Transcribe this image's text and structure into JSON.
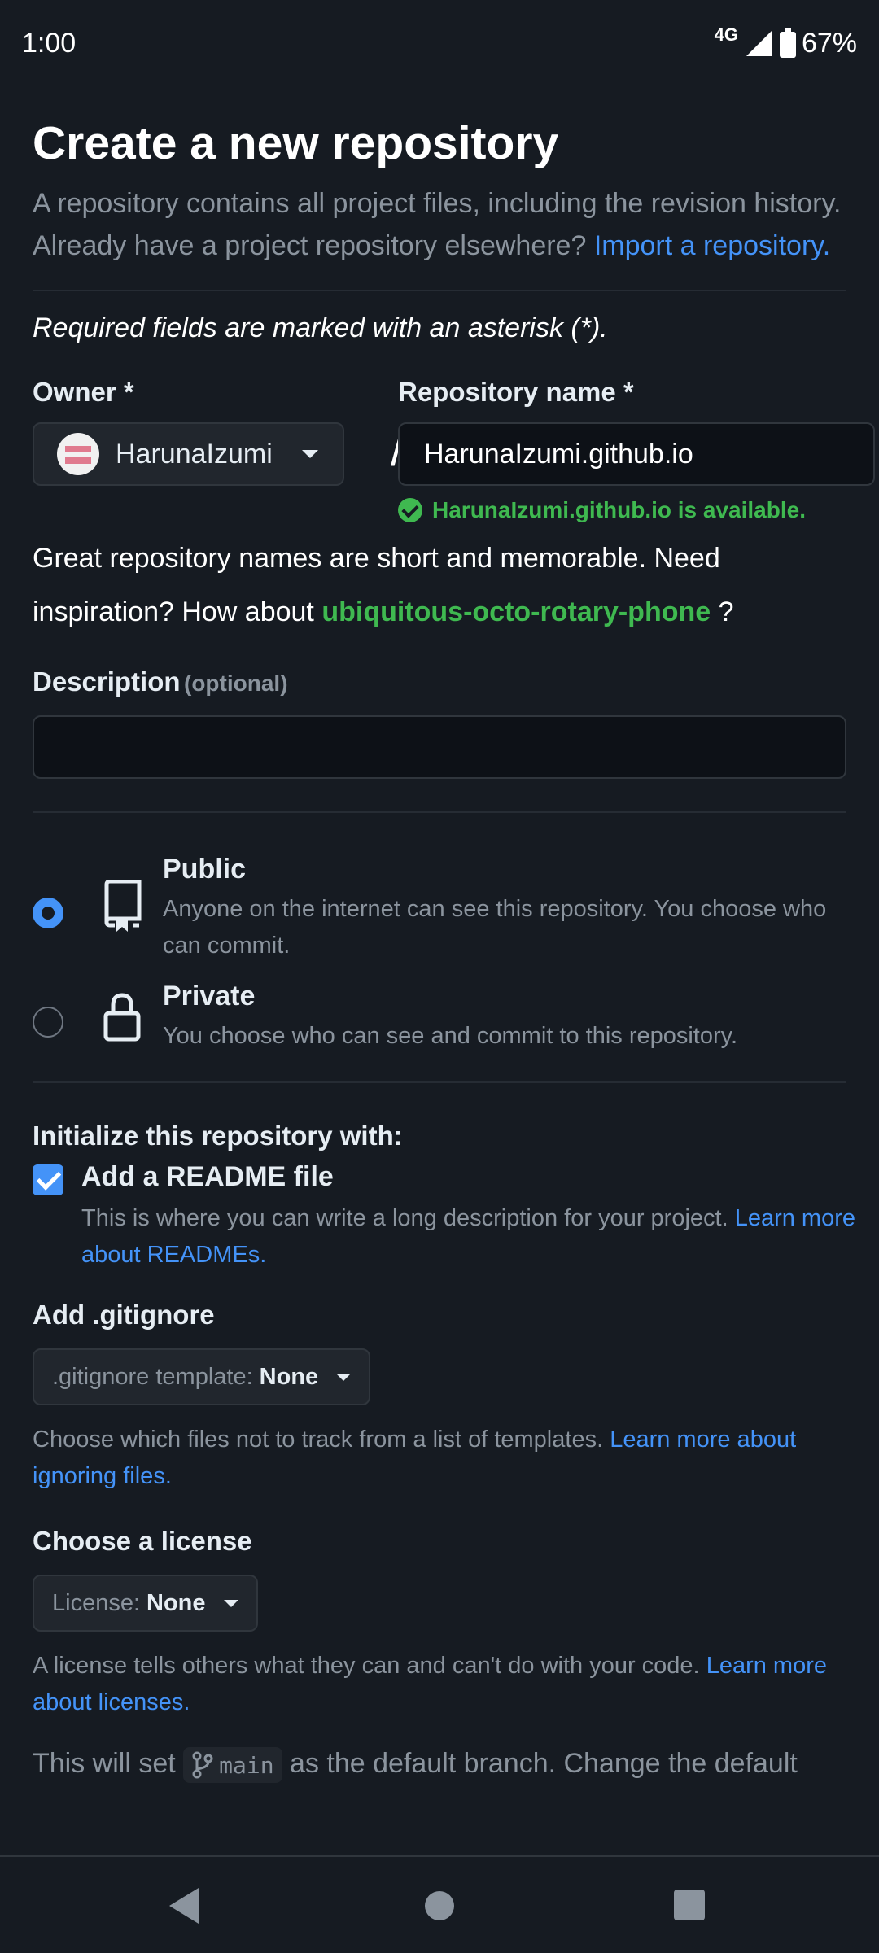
{
  "status_bar": {
    "time": "1:00",
    "network": "4G",
    "battery": "67%"
  },
  "page": {
    "title": "Create a new repository",
    "intro_text": "A repository contains all project files, including the revision history. Already have a project repository elsewhere?",
    "import_link": "Import a repository.",
    "required_note": "Required fields are marked with an asterisk (*)."
  },
  "owner": {
    "label": "Owner *",
    "value": "HarunaIzumi"
  },
  "separator": "/",
  "repo_name": {
    "label": "Repository name *",
    "value": "HarunaIzumi.github.io",
    "availability": "HarunaIzumi.github.io is available."
  },
  "suggestion": {
    "prefix": "Great repository names are short and memorable. Need inspiration? How about",
    "name": "ubiquitous-octo-rotary-phone",
    "suffix": "?"
  },
  "description": {
    "label": "Description",
    "optional": "(optional)",
    "value": ""
  },
  "visibility": {
    "options": [
      {
        "title": "Public",
        "desc": "Anyone on the internet can see this repository. You choose who can commit.",
        "selected": true,
        "icon": "repo-icon"
      },
      {
        "title": "Private",
        "desc": "You choose who can see and commit to this repository.",
        "selected": false,
        "icon": "lock-icon"
      }
    ]
  },
  "initialize": {
    "label": "Initialize this repository with:",
    "readme_label": "Add a README file",
    "readme_checked": true,
    "readme_desc": "This is where you can write a long description for your project.",
    "readme_link": "Learn more about READMEs."
  },
  "gitignore": {
    "label": "Add .gitignore",
    "select_key": ".gitignore template:",
    "select_value": "None",
    "help": "Choose which files not to track from a list of templates.",
    "help_link": "Learn more about ignoring files."
  },
  "license": {
    "label": "Choose a license",
    "select_key": "License:",
    "select_value": "None",
    "help": "A license tells others what they can and can't do with your code.",
    "help_link": "Learn more about licenses."
  },
  "branch": {
    "prefix": "This will set",
    "name": "main",
    "suffix": "as the default branch. Change the default"
  },
  "colors": {
    "accent": "#4493f8",
    "success": "#3fb950",
    "background": "#161b22"
  }
}
